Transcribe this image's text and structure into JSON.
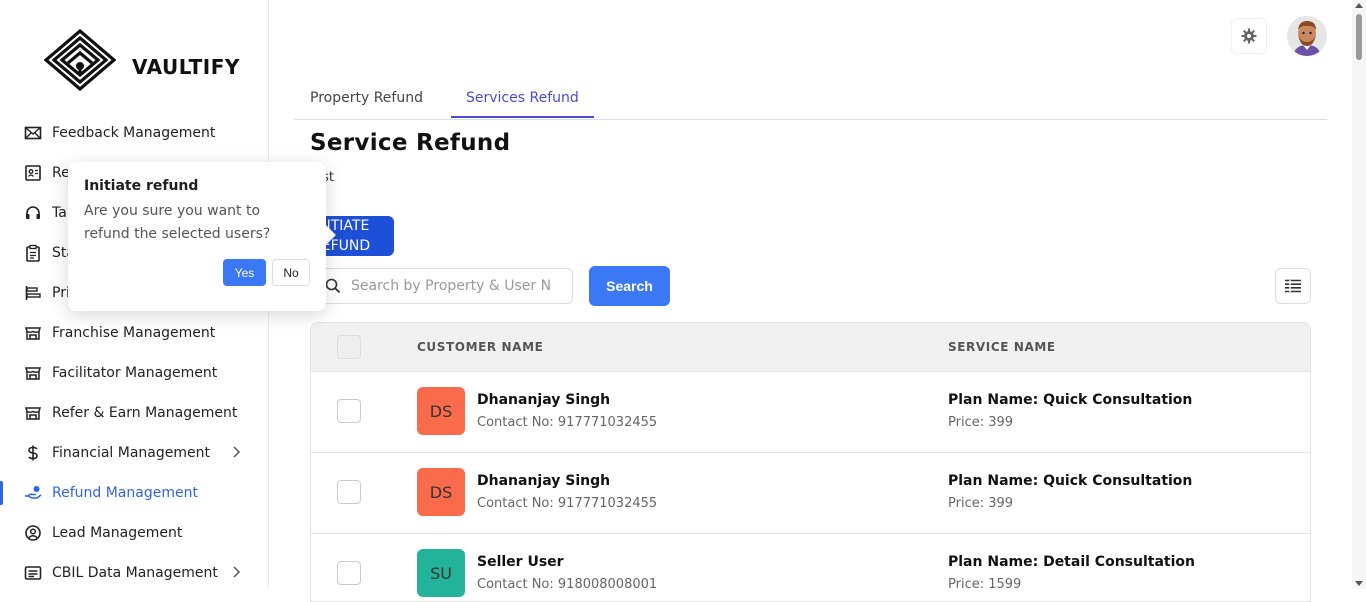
{
  "brand": {
    "name": "VAULTIFY"
  },
  "sidebar": {
    "items": [
      {
        "label": "Feedback Management",
        "icon": "mail-icon"
      },
      {
        "label": "Re",
        "icon": "contact-card-icon"
      },
      {
        "label": "Ta",
        "icon": "headset-icon"
      },
      {
        "label": "Sta",
        "icon": "clipboard-icon"
      },
      {
        "label": "Pri",
        "icon": "priority-icon"
      },
      {
        "label": "Franchise Management",
        "icon": "store-icon"
      },
      {
        "label": "Facilitator Management",
        "icon": "store-icon"
      },
      {
        "label": "Refer & Earn Management",
        "icon": "store-icon"
      },
      {
        "label": "Financial Management",
        "icon": "dollar-icon"
      },
      {
        "label": "Refund Management",
        "icon": "refund-hand-icon"
      },
      {
        "label": "Lead Management",
        "icon": "user-target-icon"
      },
      {
        "label": "CBIL Data Management",
        "icon": "list-box-icon"
      }
    ]
  },
  "popover": {
    "title": "Initiate refund",
    "message": "Are you sure you want to refund the selected users?",
    "yes_label": "Yes",
    "no_label": "No"
  },
  "tabs": [
    {
      "label": "Property Refund"
    },
    {
      "label": "Services Refund"
    }
  ],
  "page": {
    "title": "Service Refund",
    "subtitle": "st",
    "initiate_line1": "INITIATE",
    "initiate_line2": "REFUND"
  },
  "search": {
    "placeholder": "Search by Property & User N",
    "button_label": "Search"
  },
  "table": {
    "headers": {
      "customer": "CUSTOMER NAME",
      "service": "SERVICE NAME"
    },
    "rows": [
      {
        "initials": "DS",
        "badge_color": "#f96b4a",
        "name": "Dhananjay Singh",
        "contact": "Contact No: 917771032455",
        "service": "Plan Name: Quick Consultation",
        "price": "Price: 399"
      },
      {
        "initials": "DS",
        "badge_color": "#f96b4a",
        "name": "Dhananjay Singh",
        "contact": "Contact No: 917771032455",
        "service": "Plan Name: Quick Consultation",
        "price": "Price: 399"
      },
      {
        "initials": "SU",
        "badge_color": "#22b39a",
        "name": "Seller User",
        "contact": "Contact No: 918008008001",
        "service": "Plan Name: Detail Consultation",
        "price": "Price: 1599"
      }
    ]
  },
  "colors": {
    "accent": "#2f63e8",
    "primary_button": "#3b78f5",
    "initiate_button": "#1d4fd8",
    "tab_active": "#4a4ad0"
  }
}
